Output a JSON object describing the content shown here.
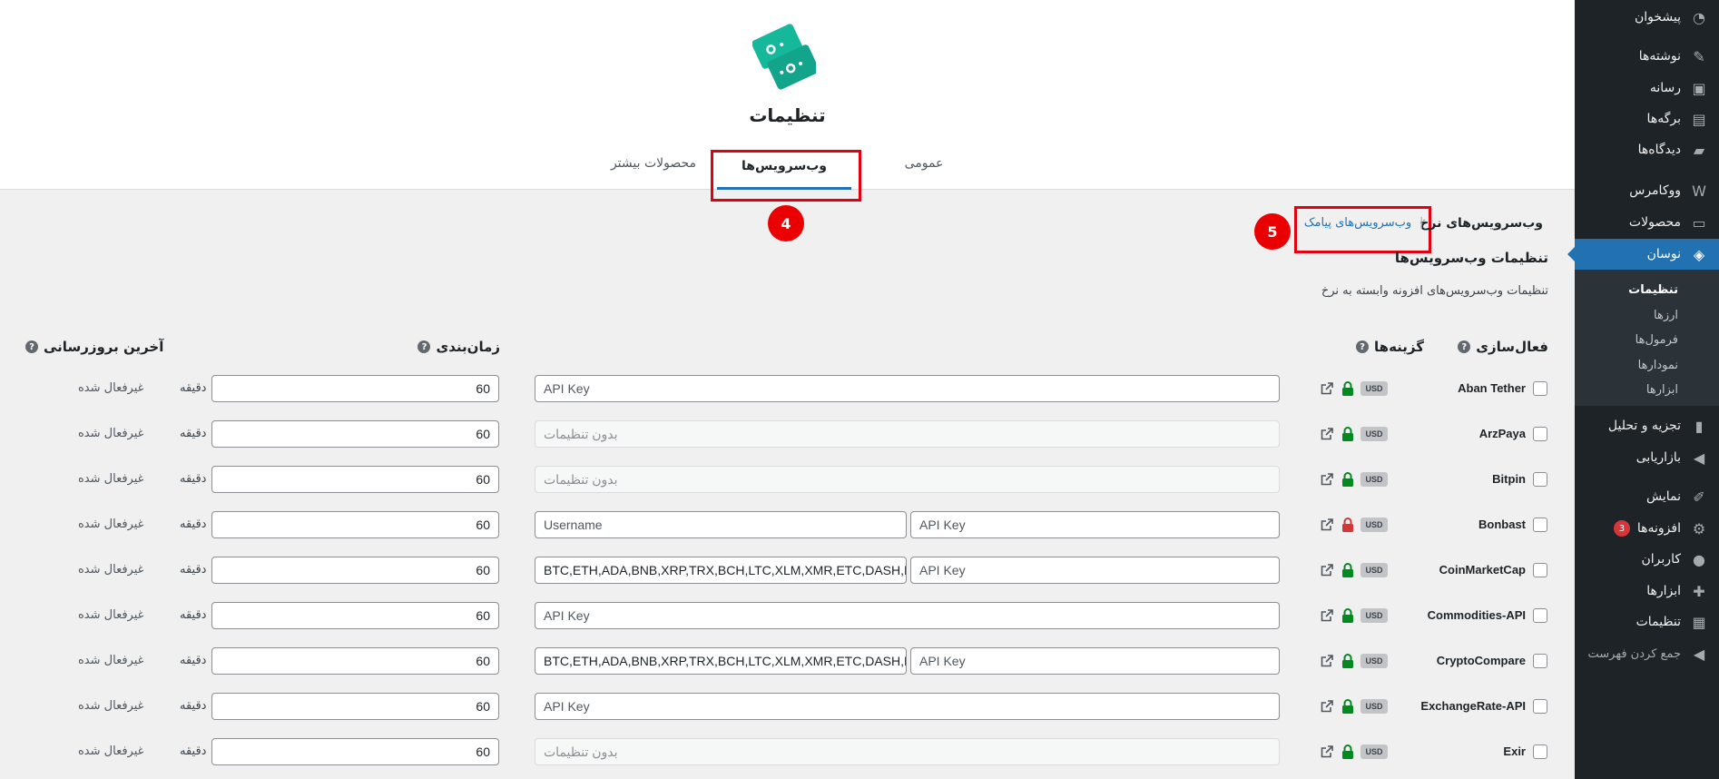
{
  "sidebar": {
    "items": [
      {
        "label": "پیشخوان",
        "icon": "dashboard-icon"
      },
      {
        "label": "نوشته‌ها",
        "icon": "pin-icon"
      },
      {
        "label": "رسانه",
        "icon": "media-icon"
      },
      {
        "label": "برگه‌ها",
        "icon": "pages-icon"
      },
      {
        "label": "دیدگاه‌ها",
        "icon": "comments-icon"
      },
      {
        "label": "ووکامرس",
        "icon": "woo-icon"
      },
      {
        "label": "محصولات",
        "icon": "archive-icon"
      },
      {
        "label": "نوسان",
        "icon": "plugin-logo-icon"
      },
      {
        "label": "تجزیه و تحلیل",
        "icon": "chart-bar-icon"
      },
      {
        "label": "بازاریابی",
        "icon": "megaphone-icon"
      },
      {
        "label": "نمایش",
        "icon": "brush-icon"
      },
      {
        "label": "افزونه‌ها",
        "icon": "plugins-icon",
        "badge": "3"
      },
      {
        "label": "کاربران",
        "icon": "users-icon"
      },
      {
        "label": "ابزارها",
        "icon": "tools-icon"
      },
      {
        "label": "تنظیمات",
        "icon": "settings-icon"
      }
    ],
    "submenu": [
      "تنظیمات",
      "ارزها",
      "فرمول‌ها",
      "نمودارها",
      "ابزارها"
    ],
    "collapse_label": "جمع کردن فهرست"
  },
  "header": {
    "title": "تنظیمات",
    "tabs": [
      "عمومی",
      "وب‌سرویس‌ها",
      "محصولات بیشتر"
    ],
    "accent": "#2271b1"
  },
  "annotations": {
    "step4": "4",
    "step5": "5",
    "highlight_color": "#e1000f"
  },
  "subnav": {
    "current": "وب‌سرویس‌های نرخ",
    "link": "وب‌سرویس‌های پیامک",
    "separator": "|"
  },
  "section": {
    "title": "تنظیمات وب‌سرویس‌ها",
    "description": "تنظیمات وب‌سرویس‌های افزونه وابسته به نرخ"
  },
  "columns": {
    "activation": "فعال‌سازی",
    "options": "گزینه‌ها",
    "schedule": "زمان‌بندی",
    "last_update": "آخرین بروزرسانی",
    "help": "?"
  },
  "currency_badge": "USD",
  "unit_label": "دقیقه",
  "status_label": "غیرفعال شده",
  "services": [
    {
      "name": "Aban Tether",
      "locked": false,
      "fields": [
        {
          "placeholder": "API Key"
        }
      ],
      "interval": "60"
    },
    {
      "name": "ArzPaya",
      "locked": false,
      "fields": [
        {
          "disabled": "بدون تنظیمات"
        }
      ],
      "interval": "60"
    },
    {
      "name": "Bitpin",
      "locked": false,
      "fields": [
        {
          "disabled": "بدون تنظیمات"
        }
      ],
      "interval": "60"
    },
    {
      "name": "Bonbast",
      "locked": true,
      "fields": [
        {
          "placeholder": "API Key"
        },
        {
          "placeholder": "Username"
        }
      ],
      "interval": "60"
    },
    {
      "name": "CoinMarketCap",
      "locked": false,
      "fields": [
        {
          "placeholder": "API Key"
        },
        {
          "value": "BTC,ETH,ADA,BNB,XRP,TRX,BCH,LTC,XLM,XMR,ETC,DASH,MIOTA"
        }
      ],
      "interval": "60"
    },
    {
      "name": "Commodities-API",
      "locked": false,
      "fields": [
        {
          "placeholder": "API Key"
        }
      ],
      "interval": "60"
    },
    {
      "name": "CryptoCompare",
      "locked": false,
      "fields": [
        {
          "placeholder": "API Key"
        },
        {
          "value": "BTC,ETH,ADA,BNB,XRP,TRX,BCH,LTC,XLM,XMR,ETC,DASH,MIOTA"
        }
      ],
      "interval": "60"
    },
    {
      "name": "ExchangeRate-API",
      "locked": false,
      "fields": [
        {
          "placeholder": "API Key"
        }
      ],
      "interval": "60"
    },
    {
      "name": "Exir",
      "locked": false,
      "fields": [
        {
          "disabled": "بدون تنظیمات"
        }
      ],
      "interval": "60"
    }
  ]
}
